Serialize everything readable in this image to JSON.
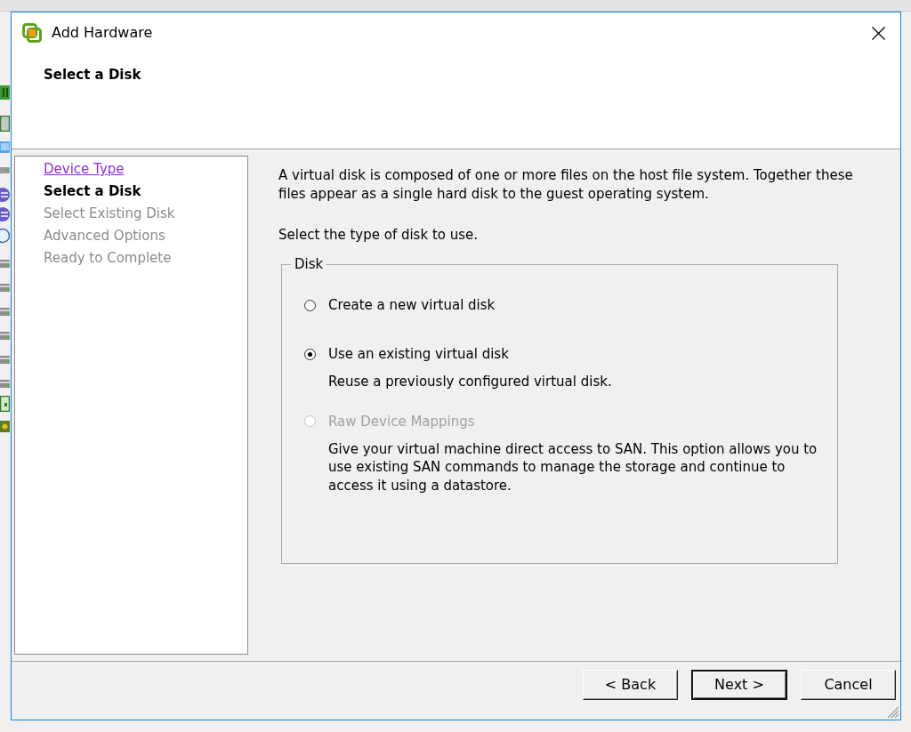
{
  "window": {
    "title": "Add Hardware"
  },
  "header": {
    "title": "Select a Disk"
  },
  "steps": [
    {
      "label": "Device Type",
      "kind": "visited"
    },
    {
      "label": "Select a Disk",
      "kind": "current"
    },
    {
      "label": "Select Existing Disk",
      "kind": "upcoming"
    },
    {
      "label": "Advanced Options",
      "kind": "upcoming"
    },
    {
      "label": "Ready to Complete",
      "kind": "upcoming"
    }
  ],
  "intro": "A virtual disk is composed of one or more files on the host file system. Together these files appear as a single hard disk to the guest operating system.",
  "prompt": "Select the type of disk to use.",
  "disk_group": {
    "legend": "Disk",
    "options": [
      {
        "label": "Create a new virtual disk",
        "selected": false,
        "disabled": false
      },
      {
        "label": "Use an existing virtual disk",
        "selected": true,
        "disabled": false,
        "description": "Reuse a previously configured virtual disk."
      },
      {
        "label": "Raw Device Mappings",
        "selected": false,
        "disabled": true,
        "description": "Give your virtual machine direct access to SAN. This option allows you to use existing SAN commands to manage the storage and continue to access it using a datastore."
      }
    ]
  },
  "buttons": [
    {
      "label": "< Back",
      "default": false
    },
    {
      "label": "Next >",
      "default": true
    },
    {
      "label": "Cancel",
      "default": false
    }
  ]
}
